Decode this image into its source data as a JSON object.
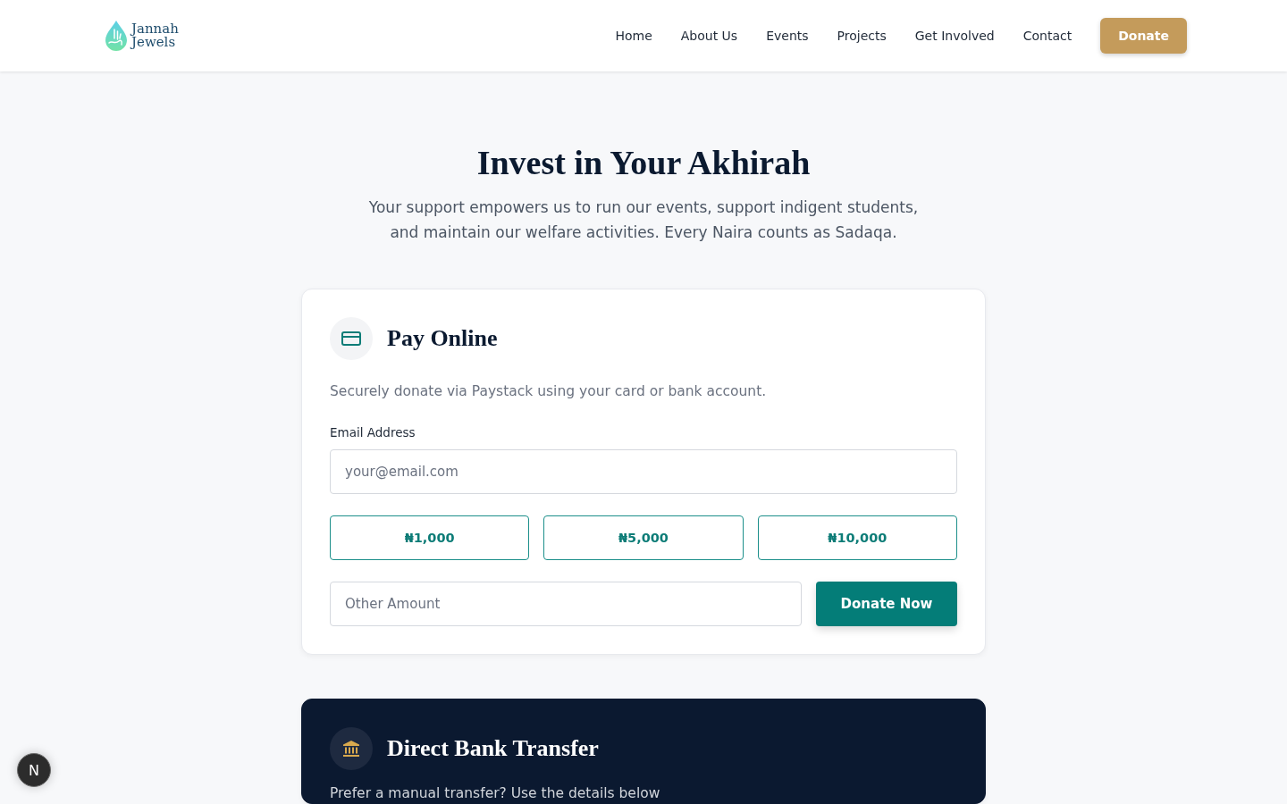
{
  "header": {
    "logo": {
      "lines": [
        "Jannah",
        "Jewels"
      ]
    },
    "nav": [
      "Home",
      "About Us",
      "Events",
      "Projects",
      "Get Involved",
      "Contact"
    ],
    "cta": "Donate"
  },
  "hero": {
    "title": "Invest in Your Akhirah",
    "subtitle": "Your support empowers us to run our events, support indigent students, and maintain our welfare activities. Every Naira counts as Sadaqa."
  },
  "pay_online": {
    "title": "Pay Online",
    "description": "Securely donate via Paystack using your card or bank account.",
    "email": {
      "label": "Email Address",
      "placeholder": "your@email.com"
    },
    "amounts": [
      {
        "label": "₦1,000",
        "selected": false
      },
      {
        "label": "₦5,000",
        "selected": false
      },
      {
        "label": "₦10,000",
        "selected": false
      }
    ],
    "other_amount": {
      "placeholder": "Other Amount"
    },
    "submit": "Donate Now"
  },
  "bank_transfer": {
    "title": "Direct Bank Transfer",
    "description": "Prefer a manual transfer? Use the details below"
  },
  "dev_badge": {
    "label": "N"
  }
}
